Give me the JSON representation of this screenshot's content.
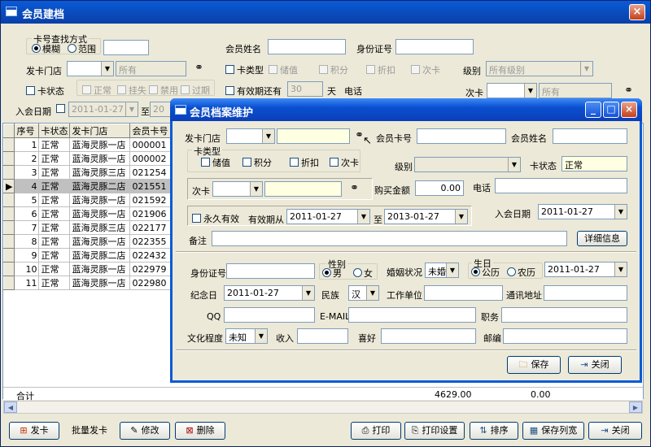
{
  "main": {
    "title": "会员建档",
    "close": "×",
    "search": {
      "group_title": "卡号查找方式",
      "mode_fuzzy": "模糊",
      "mode_range": "范围",
      "name_label": "会员姓名",
      "id_label": "身份证号",
      "issue_store_label": "发卡门店",
      "issue_store_value": "所有",
      "card_type_label": "卡类型",
      "card_types": [
        "储值",
        "积分",
        "折扣",
        "次卡"
      ],
      "level_label": "级别",
      "level_value": "所有级别",
      "card_status_label": "卡状态",
      "statuses": [
        "正常",
        "挂失",
        "禁用",
        "过期"
      ],
      "valid_label": "有效期还有",
      "valid_days": "30",
      "days_unit": "天",
      "phone_label": "电话",
      "times_card_label": "次卡",
      "times_card_value": "所有",
      "join_date_label": "入会日期",
      "join_date_from": "2011-01-27",
      "join_date_to_label": "至",
      "join_date_to": "20"
    },
    "grid": {
      "headers": [
        "序号",
        "卡状态",
        "发卡门店",
        "会员卡号"
      ],
      "rows": [
        {
          "no": "1",
          "status": "正常",
          "store": "蓝海灵豚一店",
          "card": "000001"
        },
        {
          "no": "2",
          "status": "正常",
          "store": "蓝海灵豚一店",
          "card": "000002"
        },
        {
          "no": "3",
          "status": "正常",
          "store": "蓝海灵豚三店",
          "card": "021254"
        },
        {
          "no": "4",
          "status": "正常",
          "store": "蓝海灵豚二店",
          "card": "021551"
        },
        {
          "no": "5",
          "status": "正常",
          "store": "蓝海灵豚一店",
          "card": "021592"
        },
        {
          "no": "6",
          "status": "正常",
          "store": "蓝海灵豚一店",
          "card": "021906"
        },
        {
          "no": "7",
          "status": "正常",
          "store": "蓝海灵豚三店",
          "card": "022177"
        },
        {
          "no": "8",
          "status": "正常",
          "store": "蓝海灵豚一店",
          "card": "022355"
        },
        {
          "no": "9",
          "status": "正常",
          "store": "蓝海灵豚二店",
          "card": "022432"
        },
        {
          "no": "10",
          "status": "正常",
          "store": "蓝海灵豚一店",
          "card": "022979"
        },
        {
          "no": "11",
          "status": "正常",
          "store": "蓝海灵豚一店",
          "card": "022980"
        }
      ],
      "total_label": "合计",
      "total_amount": "4629.00",
      "total_other": "0.00"
    },
    "toolbar": {
      "issue_card": "发卡",
      "batch_issue": "批量发卡",
      "edit": "修改",
      "delete": "删除",
      "print": "打印",
      "print_setup": "打印设置",
      "sort": "排序",
      "save_width": "保存列宽",
      "close": "关闭"
    }
  },
  "dialog": {
    "title": "会员档案维护",
    "minimize": "_",
    "maximize": "□",
    "close": "×",
    "issue_store_label": "发卡门店",
    "card_no_label": "会员卡号",
    "member_name_label": "会员姓名",
    "card_type_group": "卡类型",
    "card_types": [
      "储值",
      "积分",
      "折扣",
      "次卡"
    ],
    "level_label": "级别",
    "card_status_label": "卡状态",
    "card_status_value": "正常",
    "times_card_label": "次卡",
    "purchase_label": "购买金额",
    "purchase_value": "0.00",
    "phone_label": "电话",
    "permanent_label": "永久有效",
    "valid_from_label": "有效期从",
    "valid_from": "2011-01-27",
    "valid_to_label": "至",
    "valid_to": "2013-01-27",
    "join_date_label": "入会日期",
    "join_date": "2011-01-27",
    "remark_label": "备注",
    "details_button": "详细信息",
    "id_label": "身份证号",
    "gender_group": "性别",
    "male": "男",
    "female": "女",
    "marital_label": "婚姻状况",
    "marital_value": "未婚",
    "birthday_group": "生日",
    "solar": "公历",
    "lunar": "农历",
    "birthday": "2011-01-27",
    "memorial_label": "纪念日",
    "memorial": "2011-01-27",
    "ethnic_label": "民族",
    "ethnic_value": "汉",
    "work_label": "工作单位",
    "address_label": "通讯地址",
    "qq_label": "QQ",
    "email_label": "E-MAIL",
    "job_label": "职务",
    "education_label": "文化程度",
    "education_value": "未知",
    "income_label": "收入",
    "hobby_label": "喜好",
    "zip_label": "邮编",
    "save_button": "保存",
    "close_button": "关闭"
  }
}
